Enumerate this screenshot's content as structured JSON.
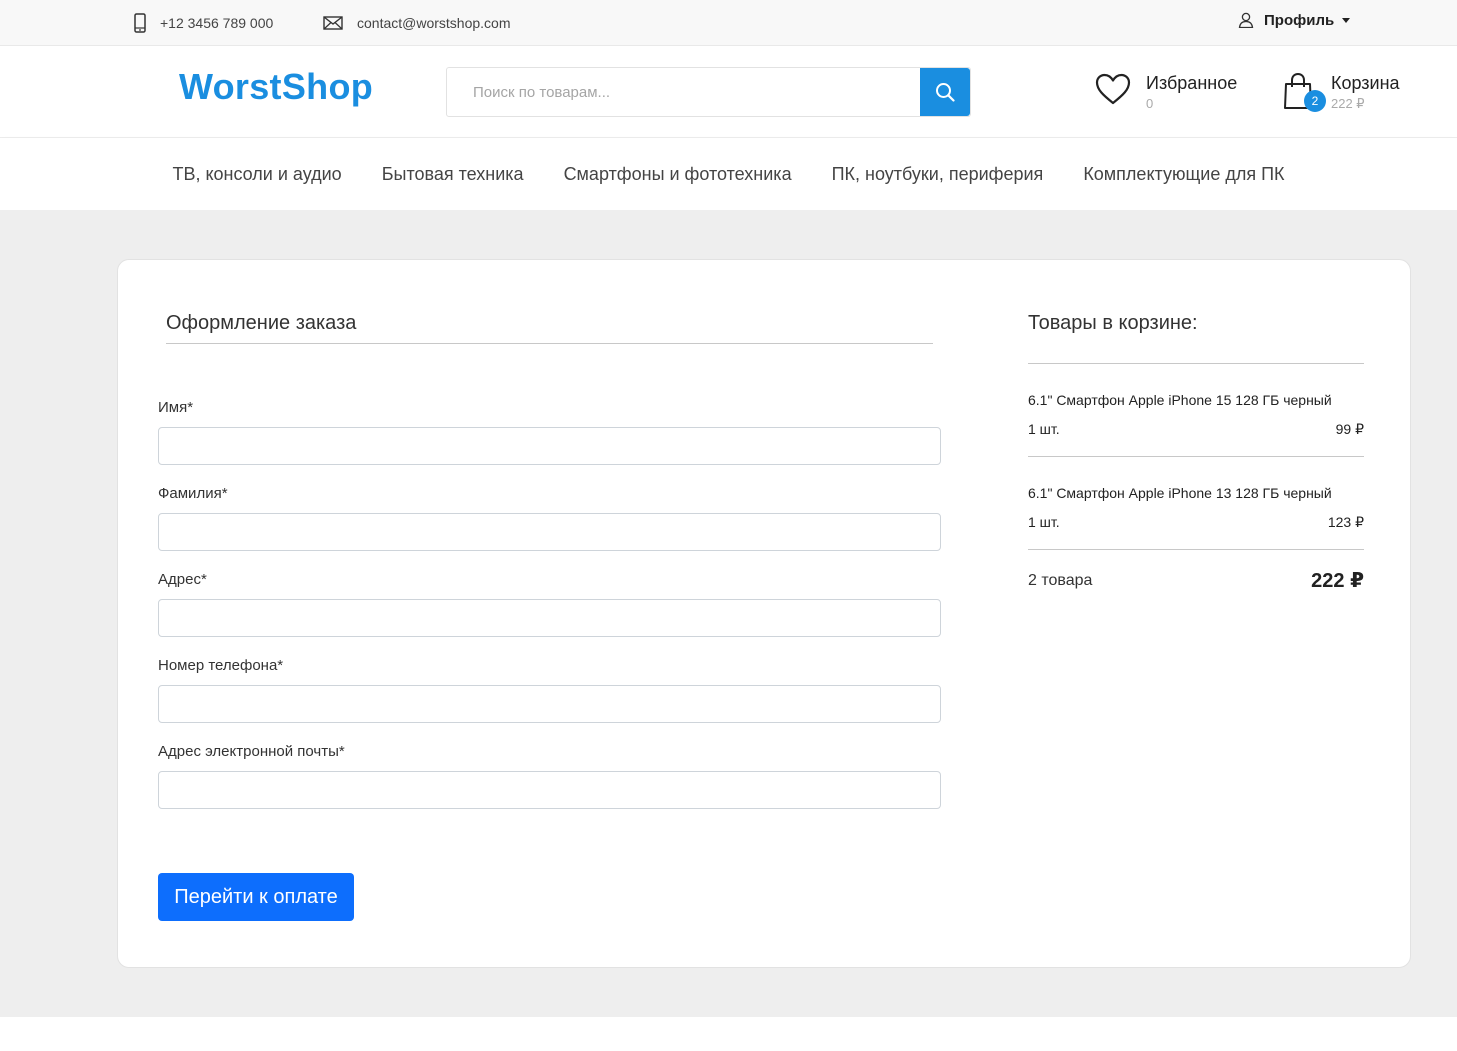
{
  "topbar": {
    "phone": "+12 3456 789 000",
    "email": "contact@worstshop.com",
    "profile": "Профиль"
  },
  "header": {
    "logo": "WorstShop",
    "search_placeholder": "Поиск по товарам...",
    "favorites": {
      "label": "Избранное",
      "count": "0"
    },
    "cart": {
      "label": "Корзина",
      "total": "222 ₽",
      "badge": "2"
    }
  },
  "nav": {
    "items": [
      "ТВ, консоли и аудио",
      "Бытовая техника",
      "Смартфоны и фототехника",
      "ПК, ноутбуки, периферия",
      "Комплектующие для ПК"
    ]
  },
  "form": {
    "title": "Оформление заказа",
    "fields": [
      {
        "label": "Имя*",
        "value": ""
      },
      {
        "label": "Фамилия*",
        "value": ""
      },
      {
        "label": "Адрес*",
        "value": ""
      },
      {
        "label": "Номер телефона*",
        "value": ""
      },
      {
        "label": "Адрес электронной почты*",
        "value": ""
      }
    ],
    "submit": "Перейти к оплате"
  },
  "summary": {
    "title": "Товары в корзине:",
    "items": [
      {
        "name": "6.1\" Смартфон Apple iPhone 15 128 ГБ черный",
        "qty": "1 шт.",
        "price": "99 ₽"
      },
      {
        "name": "6.1\" Смартфон Apple iPhone 13 128 ГБ черный",
        "qty": "1 шт.",
        "price": "123 ₽"
      }
    ],
    "count": "2 товара",
    "total": "222 ₽"
  },
  "colors": {
    "brand": "#1a8ee0",
    "primary_button": "#0d6efd",
    "background": "#eeeeee"
  }
}
